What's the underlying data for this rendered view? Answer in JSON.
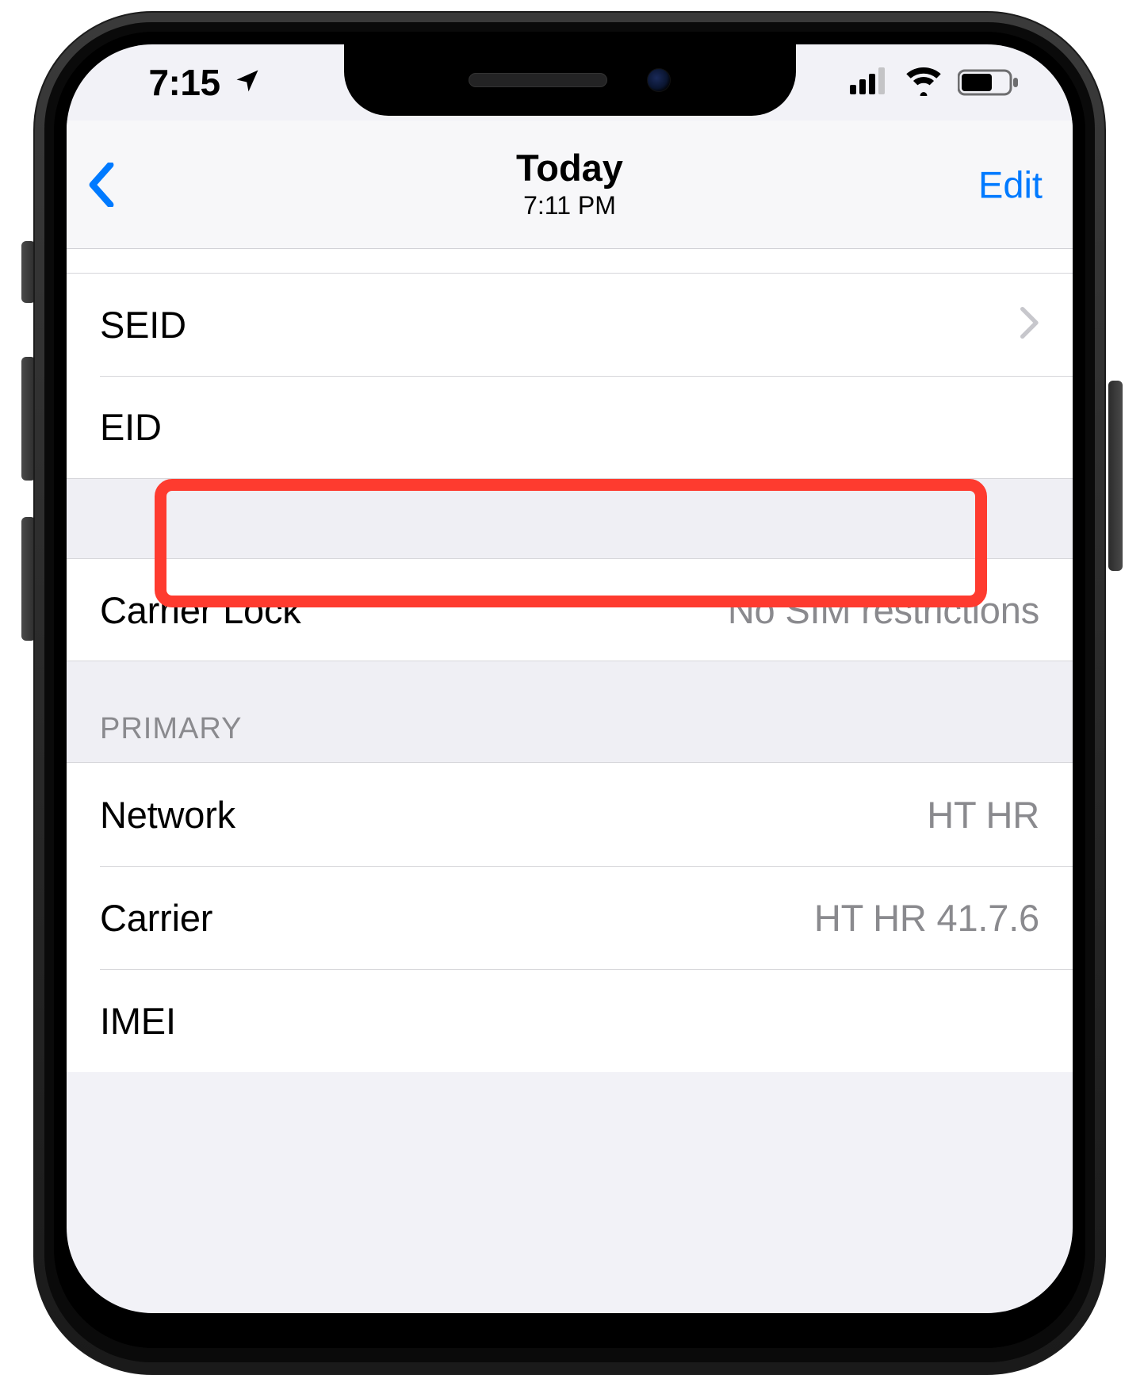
{
  "statusBar": {
    "time": "7:15"
  },
  "nav": {
    "title": "Today",
    "subtitle": "7:11 PM",
    "editLabel": "Edit"
  },
  "group1": [
    {
      "label": "SEID",
      "value": "",
      "disclosure": true
    },
    {
      "label": "EID",
      "value": "",
      "disclosure": false
    }
  ],
  "group2": [
    {
      "label": "Carrier Lock",
      "value": "No SIM restrictions",
      "disclosure": false
    }
  ],
  "section2Header": "PRIMARY",
  "group3": [
    {
      "label": "Network",
      "value": "HT HR",
      "disclosure": false
    },
    {
      "label": "Carrier",
      "value": "HT HR 41.7.6",
      "disclosure": false
    },
    {
      "label": "IMEI",
      "value": "",
      "disclosure": false
    }
  ]
}
